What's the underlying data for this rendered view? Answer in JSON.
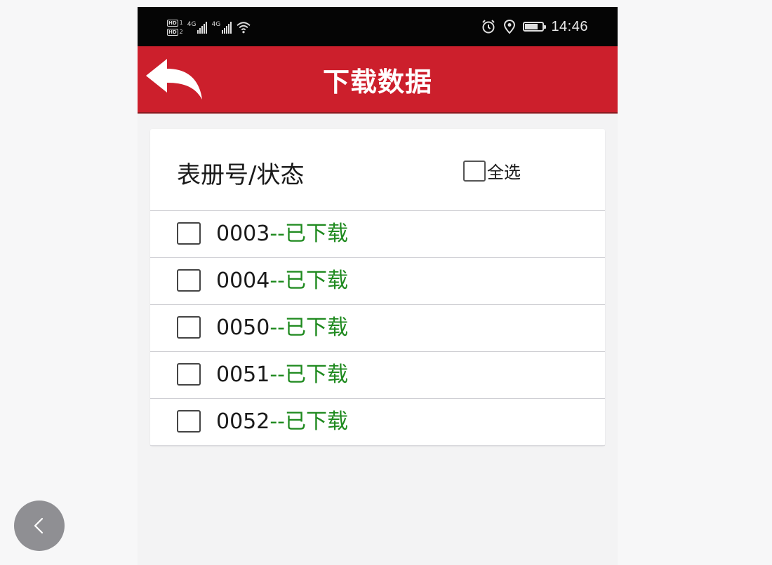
{
  "status_bar": {
    "sim1": "1",
    "sim2": "2",
    "network1": "4G",
    "network2": "4G",
    "time": "14:46",
    "battery_level": 0.75
  },
  "header": {
    "title": "下载数据"
  },
  "list_header": {
    "column_label": "表册号/状态",
    "select_all_label": "全选"
  },
  "rows": [
    {
      "code": "0003",
      "separator": "--",
      "status": "已下载",
      "checked": false
    },
    {
      "code": "0004",
      "separator": "--",
      "status": "已下载",
      "checked": false
    },
    {
      "code": "0050",
      "separator": "--",
      "status": "已下载",
      "checked": false
    },
    {
      "code": "0051",
      "separator": "--",
      "status": "已下载",
      "checked": false
    },
    {
      "code": "0052",
      "separator": "--",
      "status": "已下载",
      "checked": false
    }
  ],
  "colors": {
    "header_red": "#cc1f2c",
    "status_green": "#1f8a1f"
  }
}
